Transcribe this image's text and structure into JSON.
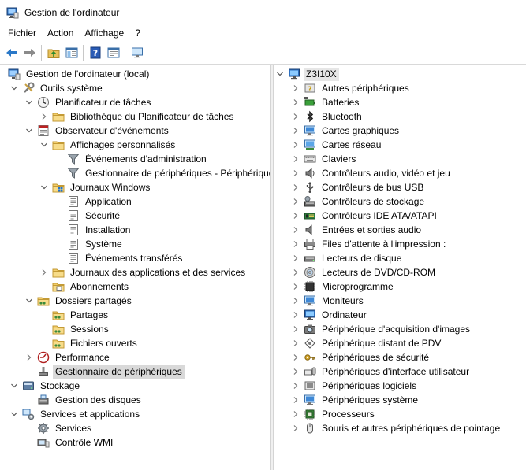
{
  "window": {
    "title": "Gestion de l'ordinateur"
  },
  "menu": [
    "Fichier",
    "Action",
    "Affichage",
    "?"
  ],
  "toolbar": {
    "buttons": [
      "back-icon",
      "forward-icon",
      "up-folder-icon",
      "show-hide-tree-icon",
      "help-icon",
      "properties-icon",
      "monitor-icon"
    ]
  },
  "left_tree": [
    {
      "label": "Gestion de l'ordinateur (local)",
      "level": 0,
      "chevron": "none",
      "icon": "computer-management-icon"
    },
    {
      "label": "Outils système",
      "level": 1,
      "chevron": "down",
      "icon": "tools-icon"
    },
    {
      "label": "Planificateur de tâches",
      "level": 2,
      "chevron": "down",
      "icon": "clock-icon"
    },
    {
      "label": "Bibliothèque du Planificateur de tâches",
      "level": 3,
      "chevron": "right",
      "icon": "folder-icon"
    },
    {
      "label": "Observateur d'événements",
      "level": 2,
      "chevron": "down",
      "icon": "event-viewer-icon"
    },
    {
      "label": "Affichages personnalisés",
      "level": 3,
      "chevron": "down",
      "icon": "folder-icon"
    },
    {
      "label": "Événements d'administration",
      "level": 4,
      "chevron": "none",
      "icon": "filter-icon"
    },
    {
      "label": "Gestionnaire de périphériques - Périphérique",
      "level": 4,
      "chevron": "none",
      "icon": "filter-icon"
    },
    {
      "label": "Journaux Windows",
      "level": 3,
      "chevron": "down",
      "icon": "windows-folder-icon"
    },
    {
      "label": "Application",
      "level": 4,
      "chevron": "none",
      "icon": "log-icon"
    },
    {
      "label": "Sécurité",
      "level": 4,
      "chevron": "none",
      "icon": "log-icon"
    },
    {
      "label": "Installation",
      "level": 4,
      "chevron": "none",
      "icon": "log-icon"
    },
    {
      "label": "Système",
      "level": 4,
      "chevron": "none",
      "icon": "log-icon"
    },
    {
      "label": "Événements transférés",
      "level": 4,
      "chevron": "none",
      "icon": "log-icon"
    },
    {
      "label": "Journaux des applications et des services",
      "level": 3,
      "chevron": "right",
      "icon": "folder-icon"
    },
    {
      "label": "Abonnements",
      "level": 3,
      "chevron": "none",
      "icon": "subscriptions-icon"
    },
    {
      "label": "Dossiers partagés",
      "level": 2,
      "chevron": "down",
      "icon": "shared-folder-icon"
    },
    {
      "label": "Partages",
      "level": 3,
      "chevron": "none",
      "icon": "shared-folder-icon"
    },
    {
      "label": "Sessions",
      "level": 3,
      "chevron": "none",
      "icon": "shared-folder-icon"
    },
    {
      "label": "Fichiers ouverts",
      "level": 3,
      "chevron": "none",
      "icon": "shared-folder-icon"
    },
    {
      "label": "Performance",
      "level": 2,
      "chevron": "right",
      "icon": "performance-icon"
    },
    {
      "label": "Gestionnaire de périphériques",
      "level": 2,
      "chevron": "none",
      "icon": "device-manager-icon",
      "selected": true
    },
    {
      "label": "Stockage",
      "level": 1,
      "chevron": "down",
      "icon": "storage-icon"
    },
    {
      "label": "Gestion des disques",
      "level": 2,
      "chevron": "none",
      "icon": "disk-management-icon"
    },
    {
      "label": "Services et applications",
      "level": 1,
      "chevron": "down",
      "icon": "services-apps-icon"
    },
    {
      "label": "Services",
      "level": 2,
      "chevron": "none",
      "icon": "gear-icon"
    },
    {
      "label": "Contrôle WMI",
      "level": 2,
      "chevron": "none",
      "icon": "wmi-icon"
    }
  ],
  "right_tree": {
    "root": "Z3I10X",
    "categories": [
      {
        "label": "Autres périphériques",
        "icon": "unknown-device-icon"
      },
      {
        "label": "Batteries",
        "icon": "battery-icon"
      },
      {
        "label": "Bluetooth",
        "icon": "bluetooth-icon"
      },
      {
        "label": "Cartes graphiques",
        "icon": "display-adapter-icon"
      },
      {
        "label": "Cartes réseau",
        "icon": "network-adapter-icon"
      },
      {
        "label": "Claviers",
        "icon": "keyboard-icon"
      },
      {
        "label": "Contrôleurs audio, vidéo et jeu",
        "icon": "speaker-icon"
      },
      {
        "label": "Contrôleurs de bus USB",
        "icon": "usb-icon"
      },
      {
        "label": "Contrôleurs de stockage",
        "icon": "storage-controller-icon"
      },
      {
        "label": "Contrôleurs IDE ATA/ATAPI",
        "icon": "ide-controller-icon"
      },
      {
        "label": "Entrées et sorties audio",
        "icon": "audio-io-icon"
      },
      {
        "label": "Files d'attente à l'impression :",
        "icon": "printer-icon"
      },
      {
        "label": "Lecteurs de disque",
        "icon": "disk-drive-icon"
      },
      {
        "label": "Lecteurs de DVD/CD-ROM",
        "icon": "dvd-icon"
      },
      {
        "label": "Microprogramme",
        "icon": "firmware-icon"
      },
      {
        "label": "Moniteurs",
        "icon": "monitor-icon"
      },
      {
        "label": "Ordinateur",
        "icon": "computer-icon"
      },
      {
        "label": "Périphérique d'acquisition d'images",
        "icon": "camera-icon"
      },
      {
        "label": "Périphérique distant de PDV",
        "icon": "pos-device-icon"
      },
      {
        "label": "Périphériques de sécurité",
        "icon": "security-key-icon"
      },
      {
        "label": "Périphériques d'interface utilisateur",
        "icon": "hid-icon"
      },
      {
        "label": "Périphériques logiciels",
        "icon": "software-device-icon"
      },
      {
        "label": "Périphériques système",
        "icon": "system-device-icon"
      },
      {
        "label": "Processeurs",
        "icon": "processor-icon"
      },
      {
        "label": "Souris et autres périphériques de pointage",
        "icon": "mouse-icon"
      }
    ]
  }
}
